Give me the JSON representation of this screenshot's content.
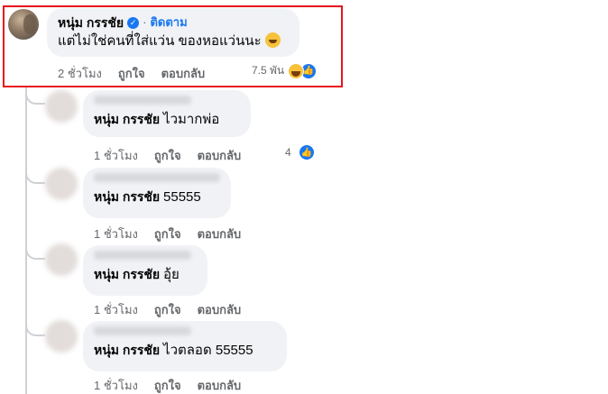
{
  "main_comment": {
    "author": "หนุ่ม กรรชัย",
    "verified_mark": "✓",
    "separator": "·",
    "follow_label": "ติดตาม",
    "text": "แต่ไม่ใช่คนที่ใส่แว่น ของหอแว่นนะ",
    "time": "2 ชั่วโมง",
    "like_label": "ถูกใจ",
    "reply_label": "ตอบกลับ",
    "reaction_count": "7.5 พัน",
    "reaction_icons": [
      "haha-icon",
      "like-icon"
    ]
  },
  "replies": [
    {
      "author": "หนุ่ม กรรชัย",
      "text": "ไวมากพ่อ",
      "time": "1 ชั่วโมง",
      "like_label": "ถูกใจ",
      "reply_label": "ตอบกลับ",
      "reaction_count": "4"
    },
    {
      "author": "หนุ่ม กรรชัย",
      "text": "55555",
      "time": "1 ชั่วโมง",
      "like_label": "ถูกใจ",
      "reply_label": "ตอบกลับ",
      "reaction_count": ""
    },
    {
      "author": "หนุ่ม กรรชัย",
      "text": "อุ้ย",
      "time": "1 ชั่วโมง",
      "like_label": "ถูกใจ",
      "reply_label": "ตอบกลับ",
      "reaction_count": ""
    },
    {
      "author": "หนุ่ม กรรชัย",
      "text": "ไวตลอด 55555",
      "time": "1 ชั่วโมง",
      "like_label": "ถูกใจ",
      "reply_label": "ตอบกลับ",
      "reaction_count": ""
    }
  ],
  "colors": {
    "highlight": "#e8141c",
    "accent": "#1877f2",
    "bubble": "#f0f2f5",
    "muted": "#65676b"
  }
}
